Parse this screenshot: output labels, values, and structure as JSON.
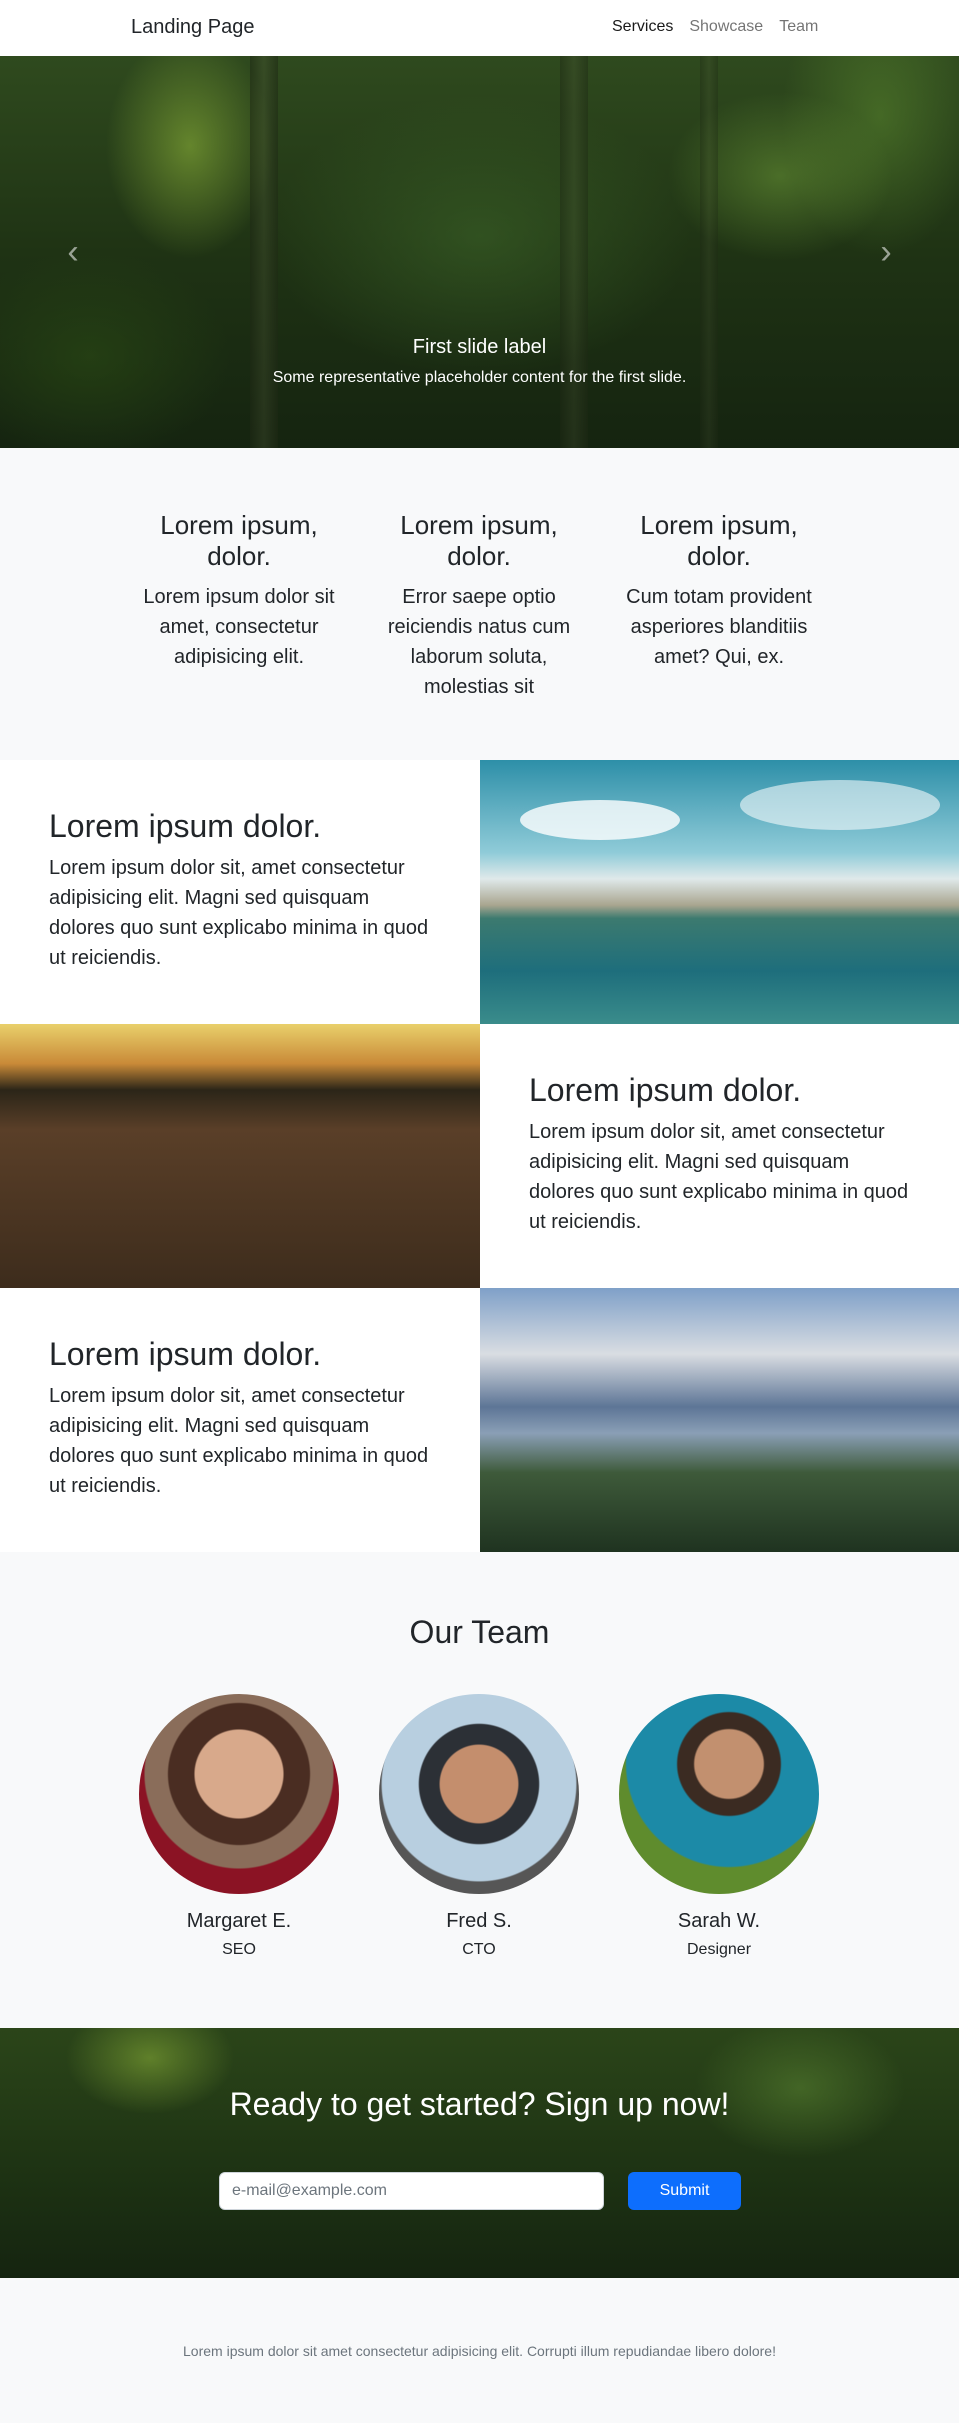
{
  "navbar": {
    "brand": "Landing Page",
    "links": [
      {
        "label": "Services",
        "active": true
      },
      {
        "label": "Showcase",
        "active": false
      },
      {
        "label": "Team",
        "active": false
      }
    ]
  },
  "hero": {
    "caption_title": "First slide label",
    "caption_text": "Some representative placeholder content for the first slide.",
    "prev_icon": "chevron-left-icon",
    "next_icon": "chevron-right-icon",
    "prev_glyph": "‹",
    "next_glyph": "›",
    "slide_count": 2,
    "active_slide": 1
  },
  "features": [
    {
      "title": "Lorem ipsum, dolor.",
      "text": "Lorem ipsum dolor sit amet, consectetur adipisicing elit."
    },
    {
      "title": "Lorem ipsum, dolor.",
      "text": "Error saepe optio reiciendis natus cum laborum soluta, molestias sit"
    },
    {
      "title": "Lorem ipsum, dolor.",
      "text": "Cum totam provident asperiores blanditiis amet? Qui, ex."
    }
  ],
  "showcase": [
    {
      "title": "Lorem ipsum dolor.",
      "text": "Lorem ipsum dolor sit, amet consectetur adipisicing elit. Magni sed quisquam dolores quo sunt explicabo minima in quod ut reiciendis.",
      "image": "lake-landscape"
    },
    {
      "title": "Lorem ipsum dolor.",
      "text": "Lorem ipsum dolor sit, amet consectetur adipisicing elit. Magni sed quisquam dolores quo sunt explicabo minima in quod ut reiciendis.",
      "image": "sunset-dock"
    },
    {
      "title": "Lorem ipsum dolor.",
      "text": "Lorem ipsum dolor sit, amet consectetur adipisicing elit. Magni sed quisquam dolores quo sunt explicabo minima in quod ut reiciendis.",
      "image": "mountain-valley"
    }
  ],
  "team": {
    "title": "Our Team",
    "members": [
      {
        "name": "Margaret E.",
        "role": "SEO"
      },
      {
        "name": "Fred S.",
        "role": "CTO"
      },
      {
        "name": "Sarah W.",
        "role": "Designer"
      }
    ]
  },
  "cta": {
    "title": "Ready to get started? Sign up now!",
    "email_placeholder": "e-mail@example.com",
    "submit_label": "Submit",
    "button_color": "#0d6efd"
  },
  "footer": {
    "text": "Lorem ipsum dolor sit amet consectetur adipisicing elit. Corrupti illum repudiandae libero dolore!"
  }
}
